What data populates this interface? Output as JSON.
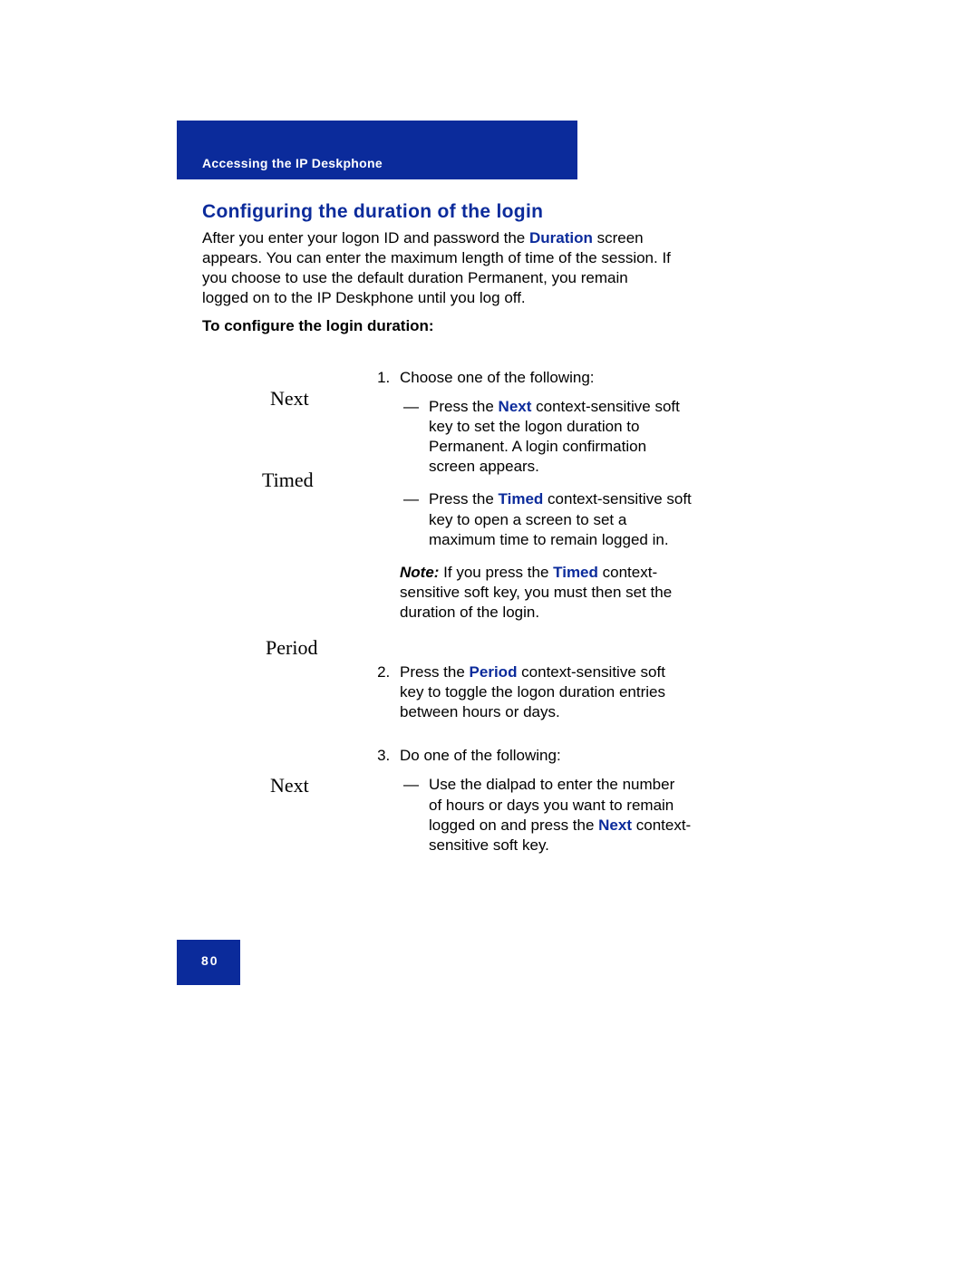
{
  "header": {
    "section": "Accessing the IP Deskphone"
  },
  "title": "Configuring the duration of the login",
  "intro": {
    "pre": "After you enter your logon ID and password the ",
    "link": "Duration",
    "post": " screen appears. You can enter the maximum length of time of the session. If you choose to use the default duration Permanent, you remain logged on to the IP Deskphone until you log off."
  },
  "subhead": "To configure the login duration:",
  "keys": {
    "next1": "Next",
    "timed": "Timed",
    "period": "Period",
    "next2": "Next"
  },
  "step1": {
    "lead": "Choose one of the following:",
    "a_pre": "Press the ",
    "a_link": "Next",
    "a_post": " context-sensitive soft key to set the logon duration to Permanent. A login confirmation screen appears.",
    "b_pre": "Press the ",
    "b_link": "Timed",
    "b_post": " context-sensitive soft key to open a screen to set a maximum time to remain logged in.",
    "note_label": "Note:",
    "note_pre": "  If you press the ",
    "note_link": "Timed",
    "note_post": " context-sensitive soft key, you must then set the duration of the login."
  },
  "step2": {
    "pre": "Press the ",
    "link": "Period",
    "post": " context-sensitive soft key to toggle the logon duration entries between hours or days."
  },
  "step3": {
    "lead": "Do one of the following:",
    "a_pre": "Use the dialpad to enter the number of hours or days you want to remain logged on and press the ",
    "a_link": "Next",
    "a_post": " context-sensitive soft key."
  },
  "footer": {
    "page": "80"
  }
}
